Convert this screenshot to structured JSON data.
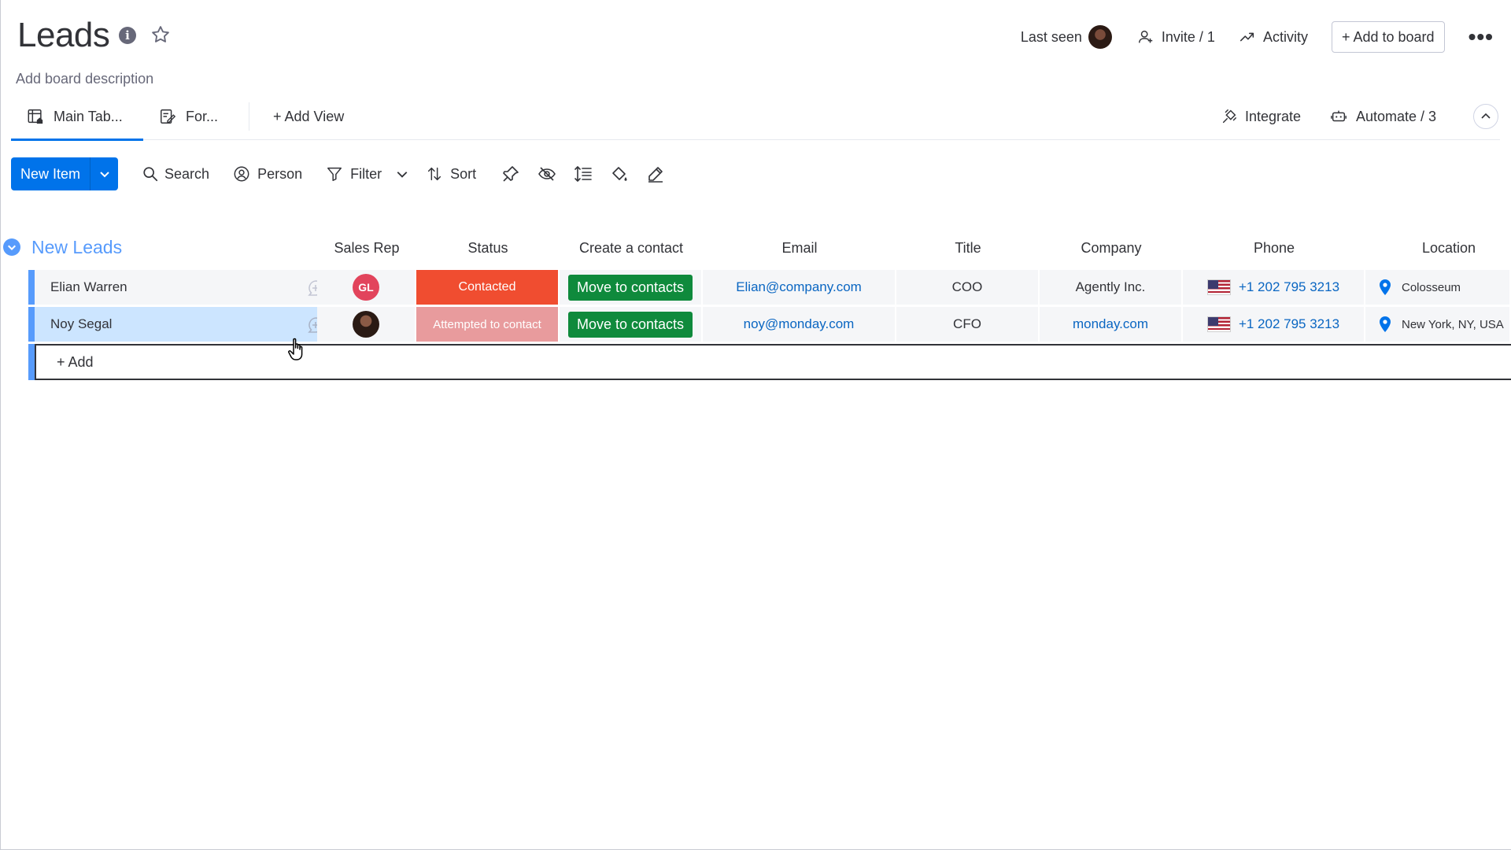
{
  "header": {
    "title": "Leads",
    "description": "Add board description",
    "last_seen_label": "Last seen",
    "invite_label": "Invite / 1",
    "activity_label": "Activity",
    "add_to_board_label": "+ Add to board",
    "more_label": "•••"
  },
  "views": {
    "tabs": [
      {
        "label": "Main Tab..."
      },
      {
        "label": "For..."
      }
    ],
    "add_view_label": "+ Add View",
    "integrate_label": "Integrate",
    "automate_label": "Automate / 3"
  },
  "toolbar": {
    "new_item_label": "New Item",
    "search_label": "Search",
    "person_label": "Person",
    "filter_label": "Filter",
    "sort_label": "Sort"
  },
  "group": {
    "title": "New Leads",
    "color": "#579bfc",
    "columns": [
      "Sales Rep",
      "Status",
      "Create a contact",
      "Email",
      "Title",
      "Company",
      "Phone",
      "Location"
    ],
    "rows": [
      {
        "name": "Elian Warren",
        "sales_rep": "GL",
        "status": "Contacted",
        "status_color": "#f04d30",
        "create_contact": "Move to contacts",
        "email": "Elian@company.com",
        "title": "COO",
        "company": "Agently Inc.",
        "phone": "+1 202 795 3213",
        "location": "Colosseum"
      },
      {
        "name": "Noy Segal",
        "sales_rep": "",
        "status": "Attempted to contact",
        "status_color": "#e89b9d",
        "create_contact": "Move to contacts",
        "email": "noy@monday.com",
        "title": "CFO",
        "company": "monday.com",
        "phone": "+1 202 795 3213",
        "location": "New York, NY, USA"
      }
    ],
    "add_label": "+ Add"
  }
}
